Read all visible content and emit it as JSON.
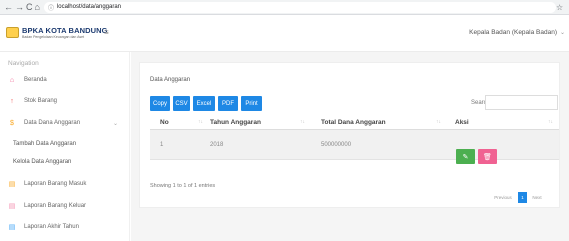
{
  "browser": {
    "url": "localhost/data/anggaran",
    "info_icon": "ⓘ",
    "nav": [
      "←",
      "→",
      "C",
      "⌂"
    ],
    "right_icons": [
      "☆",
      "⋮"
    ]
  },
  "header": {
    "brand_title": "BPKA KOTA BANDUNG",
    "brand_sub": "Badan Pengelolaan Keuangan dan Aset",
    "user_label": "Kepala Badan (Kepala Badan)",
    "user_caret": "⌄",
    "menu_icon": "≡"
  },
  "sidebar": {
    "header": "Navigation",
    "items": [
      {
        "label": "Beranda",
        "icon": "⌂",
        "color": "#f06292"
      },
      {
        "label": "Stok Barang",
        "icon": "↑",
        "color": "#ef5350"
      },
      {
        "label": "Data Dana Anggaran",
        "icon": "$",
        "color": "#f9a825",
        "caret": "⌄"
      },
      {
        "label": "Tambah Data Anggaran"
      },
      {
        "label": "Kelola Data Anggaran"
      },
      {
        "label": "Laporan Barang Masuk",
        "icon": "▤",
        "color": "#f9a825"
      },
      {
        "label": "Laporan Barang Keluar",
        "icon": "▤",
        "color": "#f48fb1"
      },
      {
        "label": "Laporan Akhir Tahun",
        "icon": "▤",
        "color": "#42a5f5"
      }
    ]
  },
  "main": {
    "card_title": "Data Anggaran",
    "export_buttons": [
      "Copy",
      "CSV",
      "Excel",
      "PDF",
      "Print"
    ],
    "search_label": "Search:",
    "columns": [
      "No",
      "Tahun Anggaran",
      "Total Dana Anggaran",
      "Aksi"
    ],
    "sort_icons": "↑↓",
    "rows": [
      {
        "no": "1",
        "tahun": "2018",
        "total": "500000000"
      }
    ],
    "edit_icon": "✎",
    "delete_icon": "🗑",
    "info": "Showing 1 to 1 of 1 entries",
    "pagination": {
      "prev": "Previous",
      "current": "1",
      "next": "Next"
    }
  },
  "colors": {
    "primary": "#1e88e5",
    "success": "#4caf50",
    "danger": "#f06292"
  }
}
